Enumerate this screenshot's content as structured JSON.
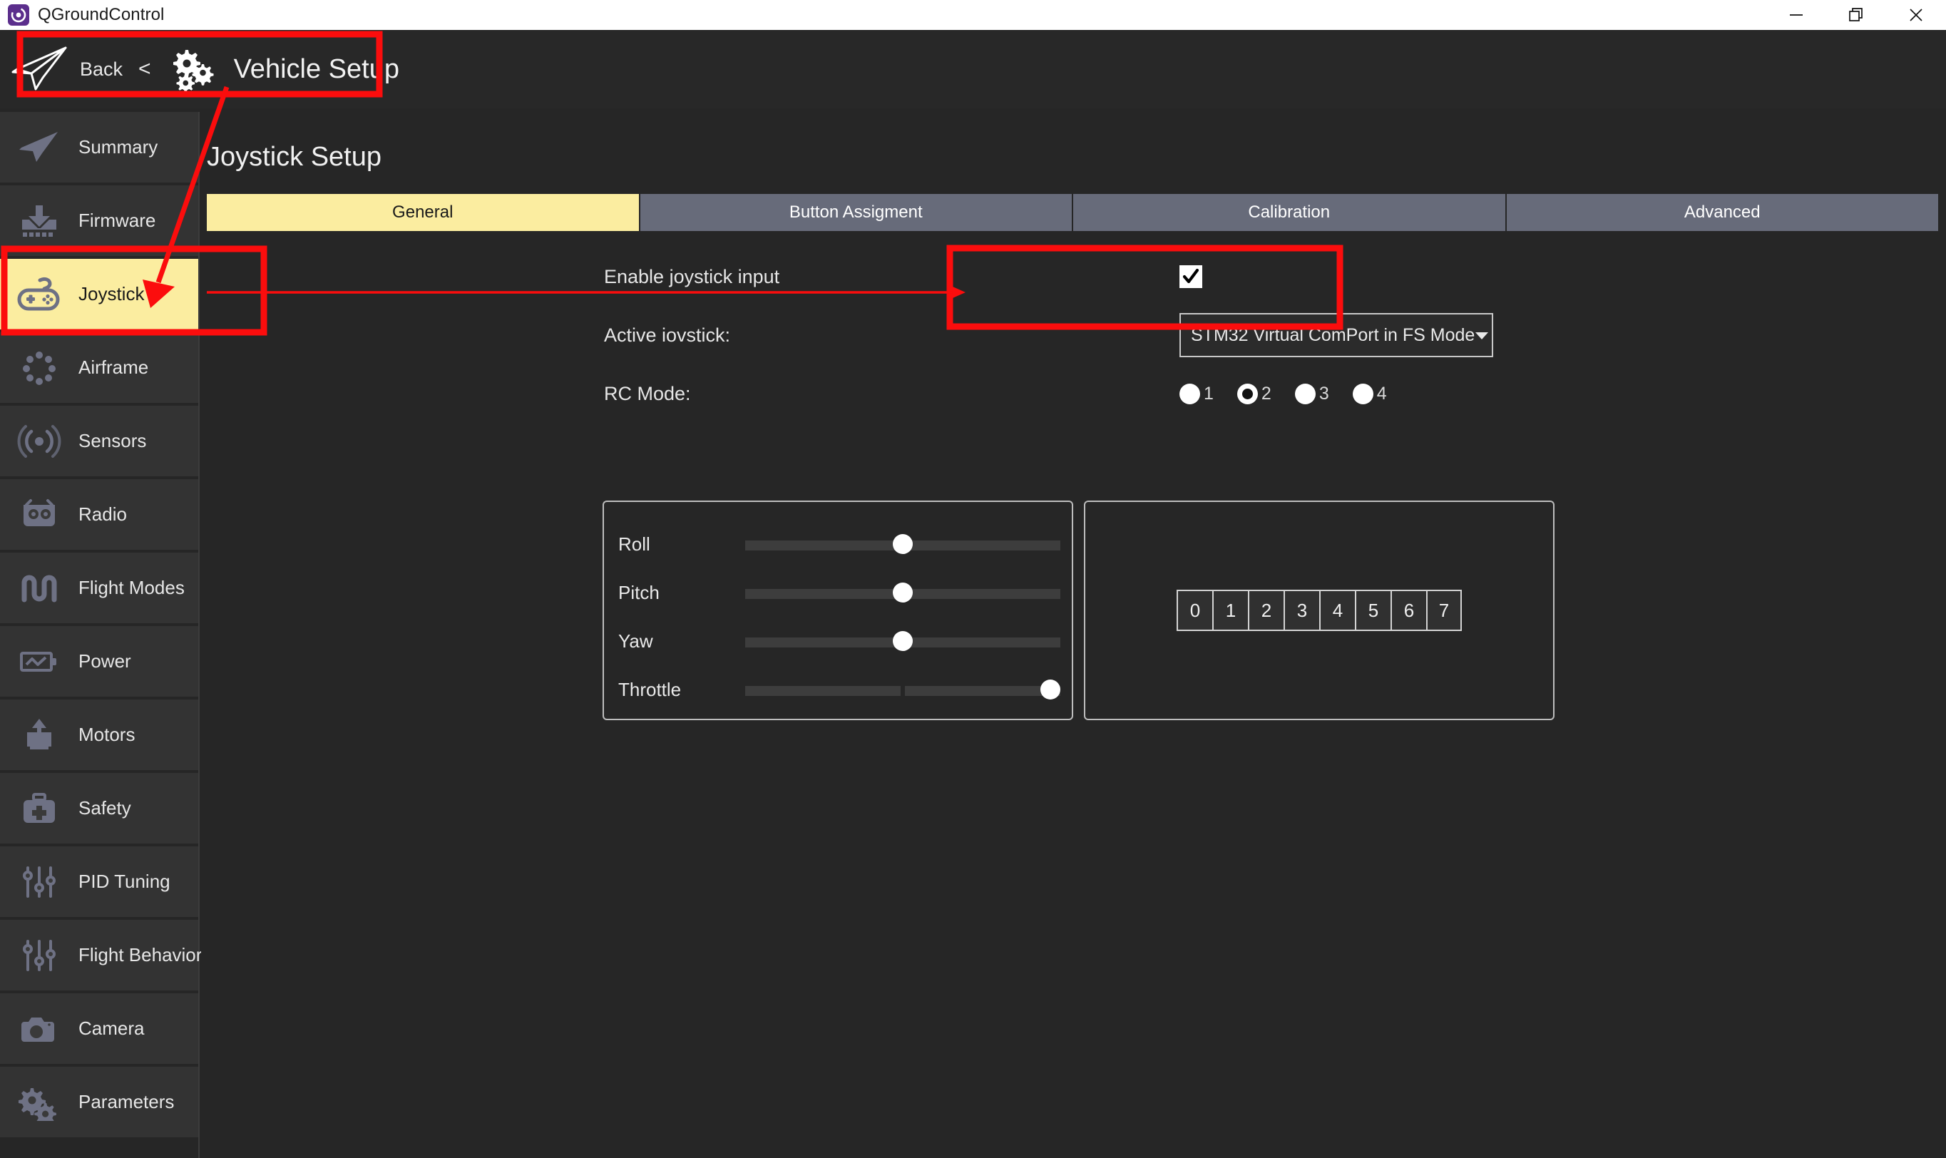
{
  "window": {
    "app_title": "QGroundControl",
    "logo_icon": "qgc-logo-icon",
    "controls": [
      {
        "name": "minimize",
        "icon": "minimize-icon"
      },
      {
        "name": "restore",
        "icon": "restore-icon"
      },
      {
        "name": "close",
        "icon": "close-icon"
      }
    ]
  },
  "toolbar": {
    "plane_icon": "paper-plane-icon",
    "back_label": "Back",
    "back_chevron": "<",
    "gears_icon": "gears-icon",
    "title": "Vehicle Setup"
  },
  "sidebar": {
    "items": [
      {
        "label": "Summary",
        "icon": "paper-plane-icon",
        "active": false
      },
      {
        "label": "Firmware",
        "icon": "download-icon",
        "active": false
      },
      {
        "label": "Joystick",
        "icon": "gamepad-icon",
        "active": true
      },
      {
        "label": "Airframe",
        "icon": "airframe-icon",
        "active": false
      },
      {
        "label": "Sensors",
        "icon": "sensors-icon",
        "active": false
      },
      {
        "label": "Radio",
        "icon": "radio-icon",
        "active": false
      },
      {
        "label": "Flight Modes",
        "icon": "flight-modes-icon",
        "active": false
      },
      {
        "label": "Power",
        "icon": "battery-icon",
        "active": false
      },
      {
        "label": "Motors",
        "icon": "motors-icon",
        "active": false
      },
      {
        "label": "Safety",
        "icon": "first-aid-icon",
        "active": false
      },
      {
        "label": "PID Tuning",
        "icon": "sliders-icon",
        "active": false
      },
      {
        "label": "Flight Behavior",
        "icon": "sliders-icon",
        "active": false
      },
      {
        "label": "Camera",
        "icon": "camera-icon",
        "active": false
      },
      {
        "label": "Parameters",
        "icon": "gears-icon",
        "active": false
      }
    ]
  },
  "main": {
    "page_title": "Joystick Setup",
    "tabs": [
      {
        "label": "General",
        "active": true
      },
      {
        "label": "Button Assigment",
        "active": false
      },
      {
        "label": "Calibration",
        "active": false
      },
      {
        "label": "Advanced",
        "active": false
      }
    ],
    "enable_joystick": {
      "label": "Enable joystick input",
      "checked": true,
      "check_icon": "checkmark-icon"
    },
    "active_joystick": {
      "label": "Active iovstick:",
      "value": "STM32 Virtual ComPort in FS Mode",
      "arrow_icon": "chevron-down-icon"
    },
    "rc_mode": {
      "label": "RC Mode:",
      "options": [
        "1",
        "2",
        "3",
        "4"
      ],
      "selected": "2"
    },
    "sticks": [
      {
        "name": "Roll",
        "value_pct": 50,
        "split": false
      },
      {
        "name": "Pitch",
        "value_pct": 50,
        "split": false
      },
      {
        "name": "Yaw",
        "value_pct": 50,
        "split": false
      },
      {
        "name": "Throttle",
        "value_pct": 100,
        "split": true
      }
    ],
    "buttons": [
      "0",
      "1",
      "2",
      "3",
      "4",
      "5",
      "6",
      "7"
    ]
  },
  "annotations": {
    "color": "#fb0d0d",
    "shapes": [
      "rect-around-vehicle-setup-toolbar",
      "rect-around-joystick-sidebar-item",
      "rect-around-active-joystick-combo",
      "arrow-vehicle-setup-to-joystick",
      "line-joystick-to-combo"
    ]
  }
}
